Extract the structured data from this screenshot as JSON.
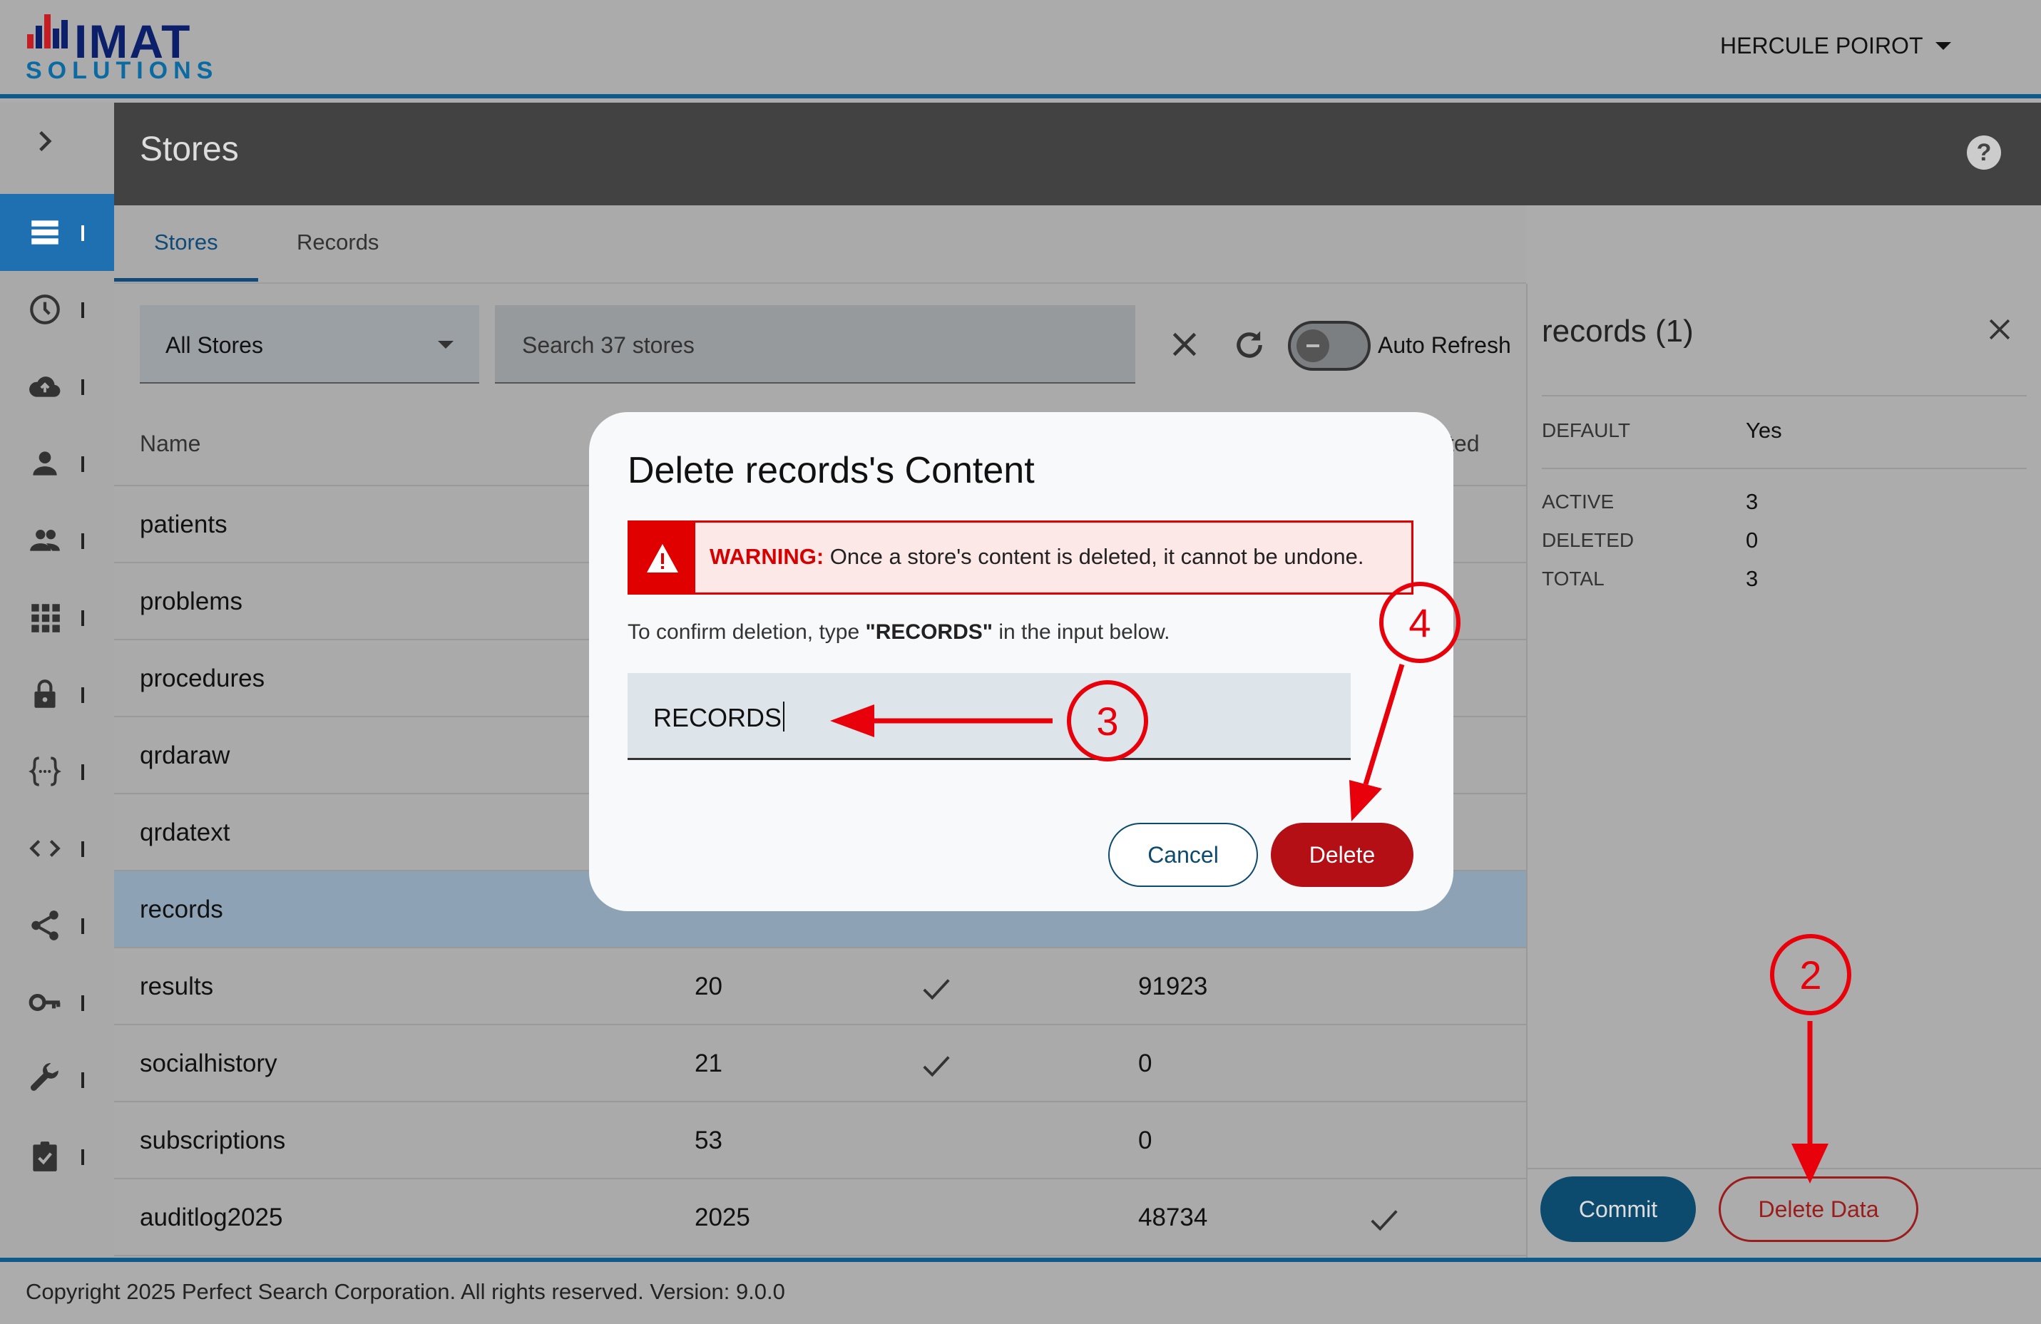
{
  "brand": {
    "line1": "IMAT",
    "line2": "SOLUTIONS",
    "accent": "#0e5a8a"
  },
  "user": {
    "name": "HERCULE POIROT"
  },
  "page": {
    "title": "Stores"
  },
  "tabs": [
    {
      "label": "Stores"
    },
    {
      "label": "Records"
    }
  ],
  "filters": {
    "store_select": "All Stores",
    "search_placeholder": "Search 37 stores",
    "auto_refresh_label": "Auto Refresh"
  },
  "table": {
    "headers": {
      "name": "Name",
      "partial": "itted"
    },
    "rows": [
      {
        "name": "patients",
        "a": "",
        "b": "",
        "c": "",
        "d": ""
      },
      {
        "name": "problems",
        "a": "",
        "b": "",
        "c": "",
        "d": ""
      },
      {
        "name": "procedures",
        "a": "",
        "b": "",
        "c": "",
        "d": ""
      },
      {
        "name": "qrdaraw",
        "a": "",
        "b": "",
        "c": "",
        "d": ""
      },
      {
        "name": "qrdatext",
        "a": "",
        "b": "",
        "c": "",
        "d": ""
      },
      {
        "name": "records",
        "a": "",
        "b": "",
        "c": "",
        "d": ""
      },
      {
        "name": "results",
        "a": "20",
        "b": "check",
        "c": "91923",
        "d": ""
      },
      {
        "name": "socialhistory",
        "a": "21",
        "b": "check",
        "c": "0",
        "d": ""
      },
      {
        "name": "subscriptions",
        "a": "53",
        "b": "",
        "c": "0",
        "d": ""
      },
      {
        "name": "auditlog2025",
        "a": "2025",
        "b": "",
        "c": "48734",
        "d": "check"
      }
    ]
  },
  "panel": {
    "title": "records (1)",
    "default_key": "DEFAULT",
    "default_val": "Yes",
    "active_key": "ACTIVE",
    "active_val": "3",
    "deleted_key": "DELETED",
    "deleted_val": "0",
    "total_key": "TOTAL",
    "total_val": "3",
    "commit_label": "Commit",
    "delete_data_label": "Delete Data"
  },
  "dialog": {
    "title": "Delete records's Content",
    "warning_label": "WARNING:",
    "warning_text": " Once a store's content is deleted, it cannot be undone.",
    "confirm_prefix": "To confirm deletion, type ",
    "confirm_word": "\"RECORDS\"",
    "confirm_suffix": " in the input below.",
    "input_value": "RECORDS",
    "cancel_label": "Cancel",
    "delete_label": "Delete"
  },
  "annotations": {
    "step2": "2",
    "step3": "3",
    "step4": "4",
    "color": "#e8000b"
  },
  "footer": {
    "text": "Copyright 2025 Perfect Search Corporation. All rights reserved. Version: 9.0.0"
  }
}
